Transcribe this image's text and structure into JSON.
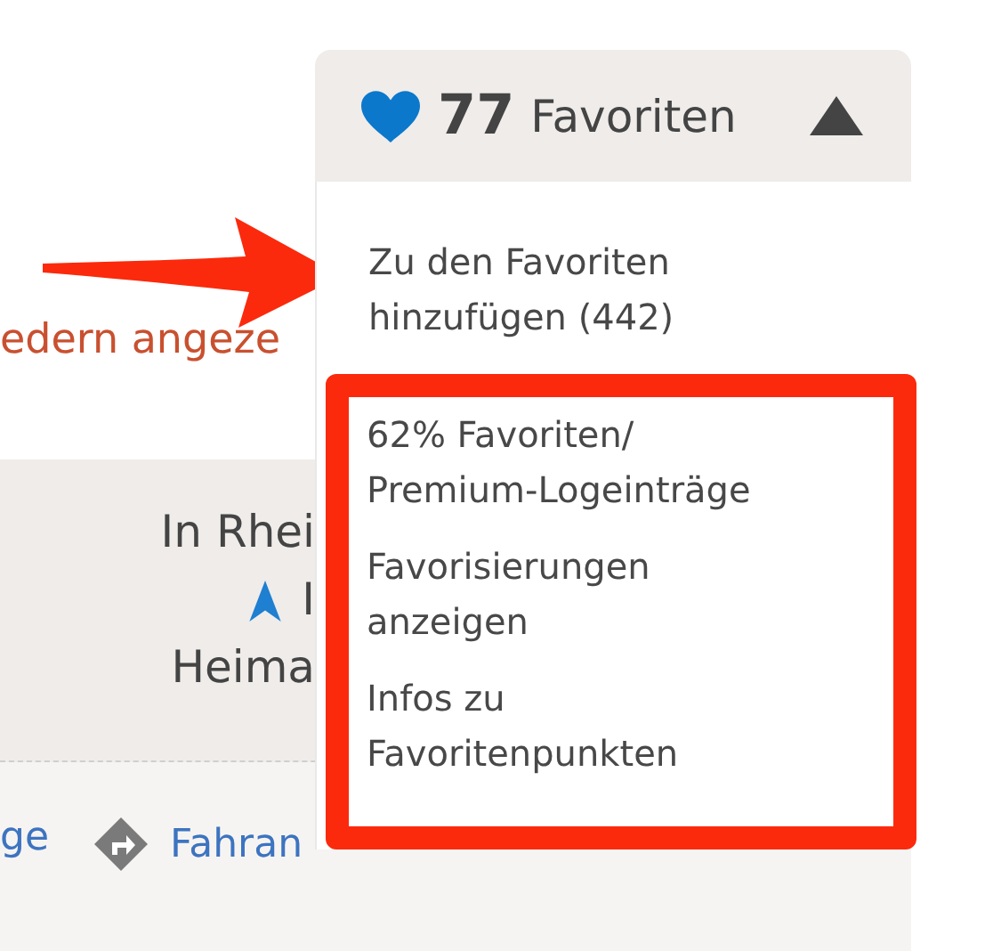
{
  "page": {
    "partial_text": "edern angeze",
    "info_panel": {
      "lines": [
        {
          "text": "In Rhei",
          "kind": "plain"
        },
        {
          "text": "I",
          "kind": "located"
        },
        {
          "text": "Heima",
          "kind": "plain"
        }
      ]
    },
    "links": [
      {
        "label": "ge",
        "kind": "plain"
      },
      {
        "label": "Fahran",
        "kind": "route"
      }
    ]
  },
  "favorites_dropdown": {
    "count": "77",
    "label": "Favoriten",
    "expanded": true,
    "items": [
      {
        "label": "Zu den Favoriten hinzufügen (442)",
        "kind": "pointed"
      },
      {
        "label": "62% Favoriten/ Premium-Logeinträge",
        "kind": "framed"
      },
      {
        "label": "Favorisierungen anzeigen",
        "kind": "framed"
      },
      {
        "label": "Infos zu Favoritenpunkten",
        "kind": "framed"
      }
    ]
  }
}
